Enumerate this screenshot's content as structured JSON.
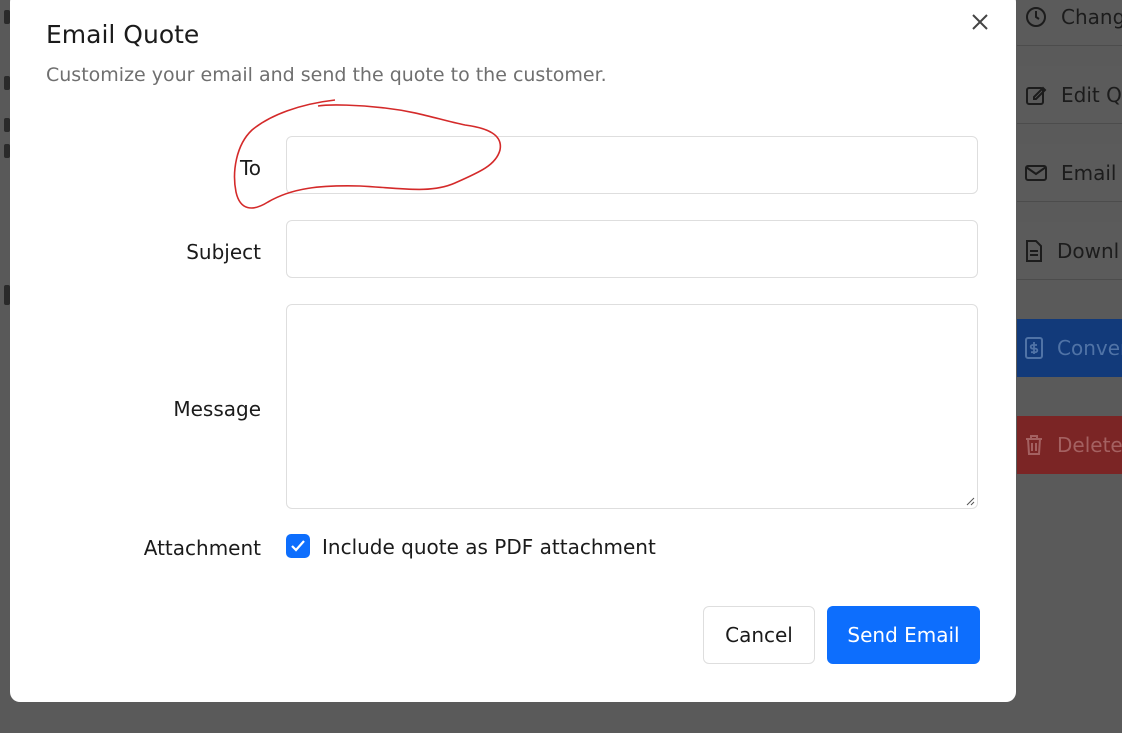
{
  "modal": {
    "title": "Email Quote",
    "subtitle": "Customize your email and send the quote to the customer."
  },
  "form": {
    "to_label": "To",
    "to_value": "",
    "subject_label": "Subject",
    "subject_value": "",
    "message_label": "Message",
    "message_value": "",
    "attachment_label": "Attachment",
    "attachment_checkbox_label": "Include quote as PDF attachment",
    "attachment_checked": true
  },
  "buttons": {
    "cancel": "Cancel",
    "send": "Send Email"
  },
  "sidebar": {
    "items": [
      {
        "label": "Change",
        "icon": "clock-icon"
      },
      {
        "label": "Edit Qu",
        "icon": "edit-icon"
      },
      {
        "label": "Email Q",
        "icon": "envelope-icon"
      },
      {
        "label": "Downl",
        "icon": "document-icon"
      },
      {
        "label": "Conver",
        "icon": "dollar-file-icon"
      },
      {
        "label": "Delete",
        "icon": "trash-icon"
      }
    ]
  },
  "colors": {
    "primary": "#0d6efd",
    "annotation": "#d42a2a"
  }
}
